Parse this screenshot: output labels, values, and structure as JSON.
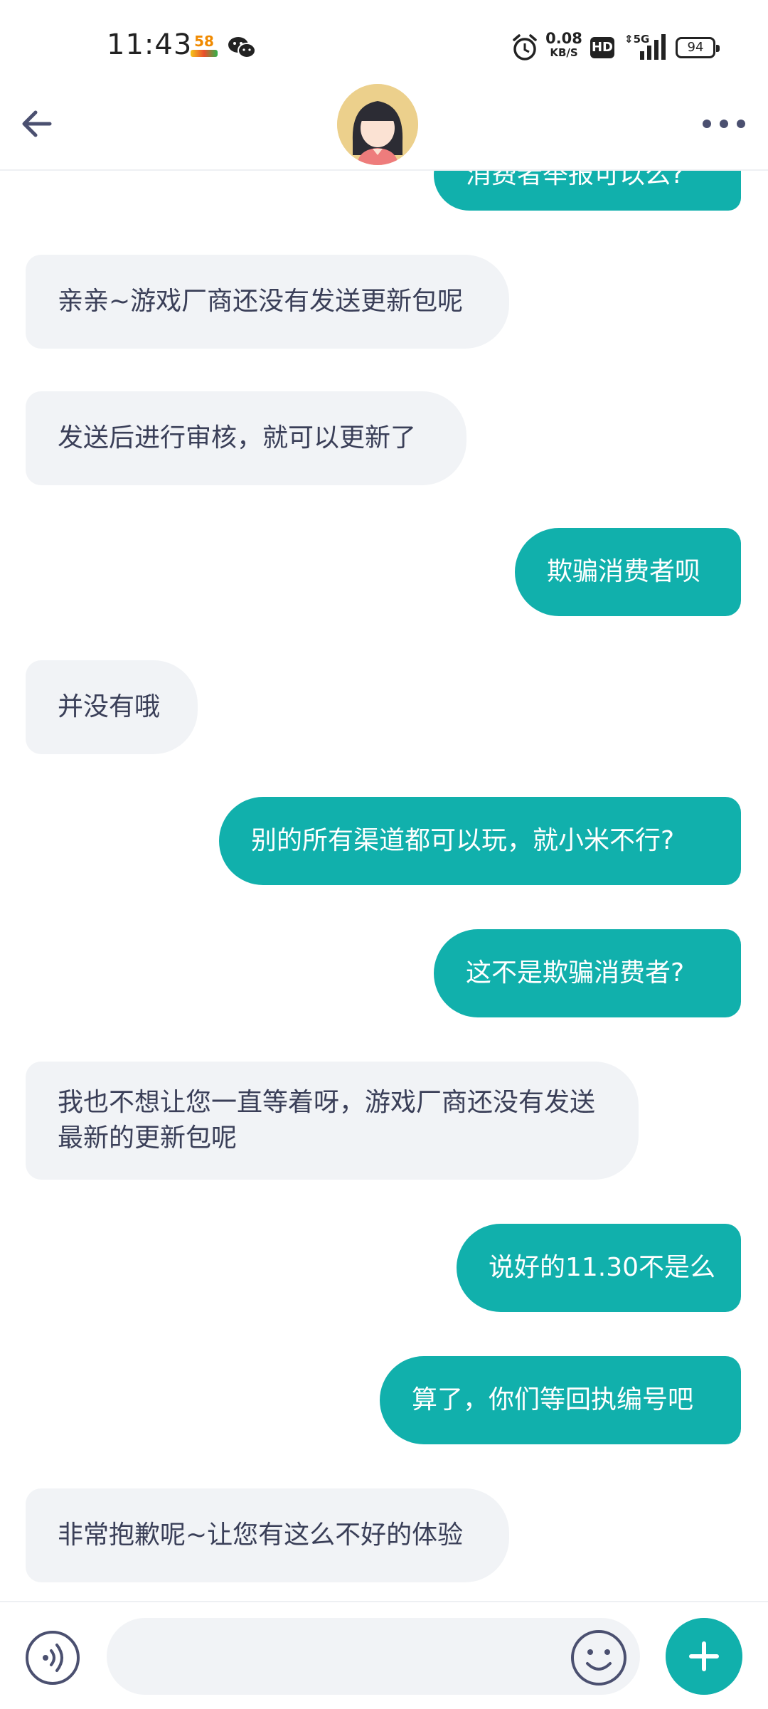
{
  "status_bar": {
    "time": "11:43",
    "app_icon_58": "58",
    "speed_value": "0.08",
    "speed_unit": "KB/S",
    "hd": "HD",
    "network": "5G",
    "battery": "94"
  },
  "header": {
    "back_icon": "arrow-left-icon",
    "avatar": "cartoon-girl-avatar",
    "more_icon": "more-dots-icon"
  },
  "messages": [
    {
      "sender": "user",
      "text": "消费者举报可以么?"
    },
    {
      "sender": "agent",
      "text": "亲亲~游戏厂商还没有发送更新包呢"
    },
    {
      "sender": "agent",
      "text": "发送后进行审核，就可以更新了"
    },
    {
      "sender": "user",
      "text": "欺骗消费者呗"
    },
    {
      "sender": "agent",
      "text": "并没有哦"
    },
    {
      "sender": "user",
      "text": "别的所有渠道都可以玩，就小米不行?"
    },
    {
      "sender": "user",
      "text": "这不是欺骗消费者?"
    },
    {
      "sender": "agent",
      "text": "我也不想让您一直等着呀，游戏厂商还没有发送最新的更新包呢"
    },
    {
      "sender": "user",
      "text": "说好的11.30不是么"
    },
    {
      "sender": "user",
      "text": "算了，你们等回执编号吧"
    },
    {
      "sender": "agent",
      "text": "非常抱歉呢~让您有这么不好的体验"
    }
  ],
  "input_bar": {
    "voice_icon": "voice-input-icon",
    "message_value": "",
    "emoji_icon": "emoji-icon",
    "plus_icon": "plus-icon"
  },
  "colors": {
    "accent": "#11b0ac",
    "agent_bubble": "#f1f3f6",
    "text": "#3a3f58"
  }
}
